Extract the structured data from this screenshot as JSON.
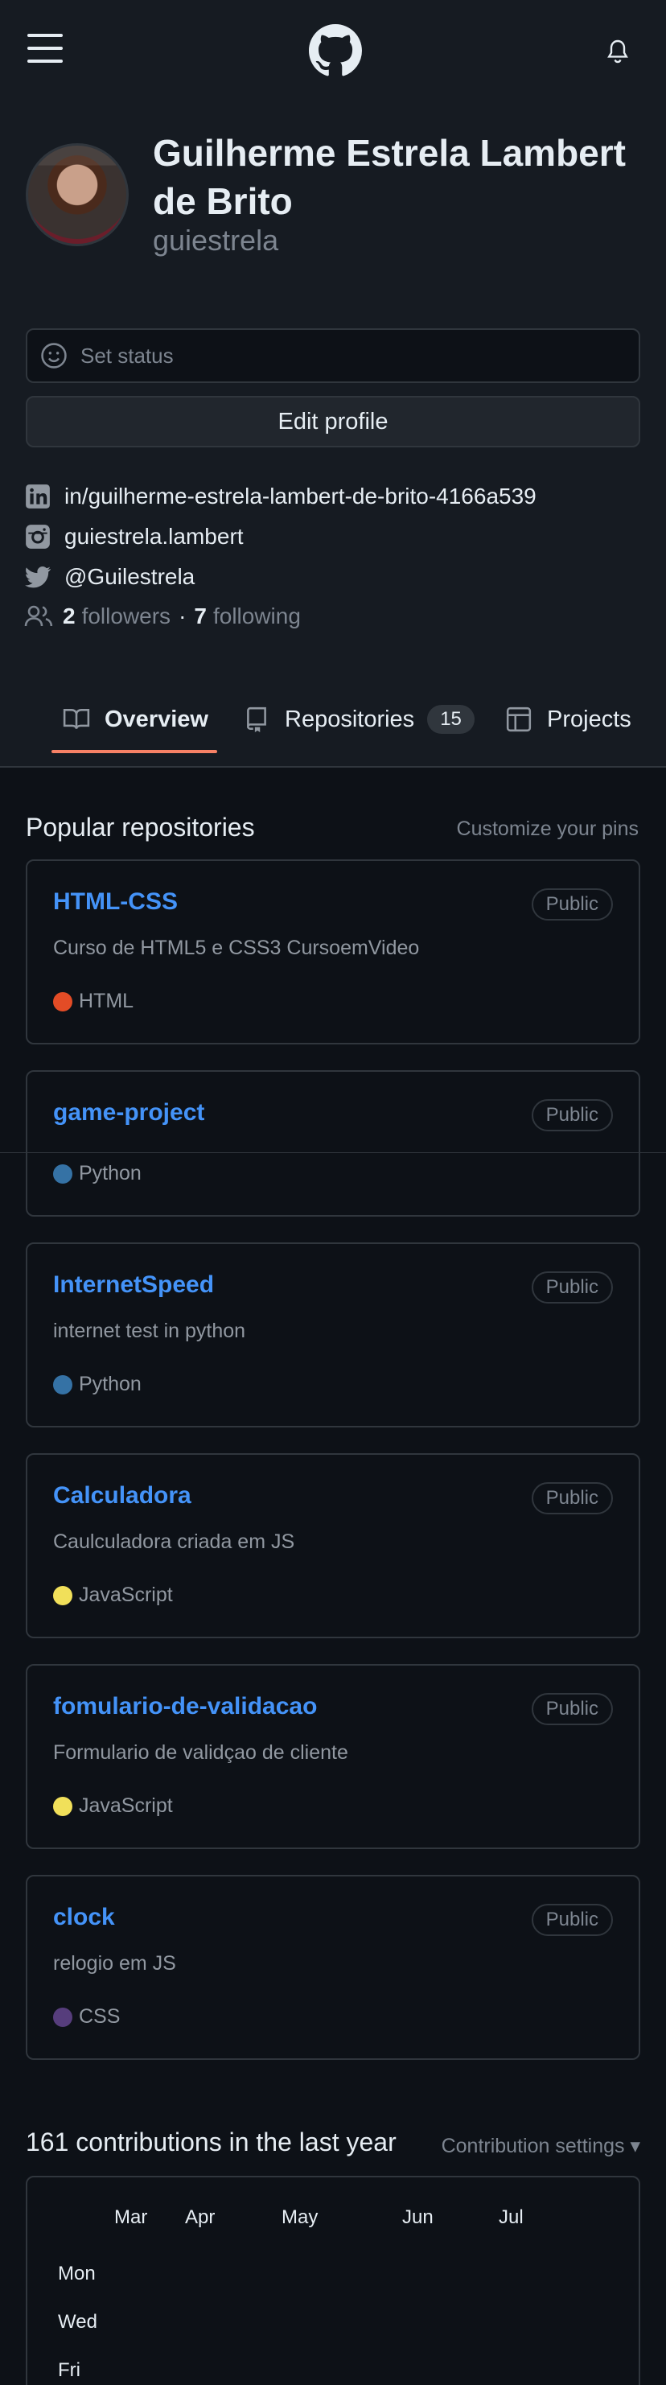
{
  "header": {
    "menu_icon": "hamburger-icon",
    "logo_icon": "github-logo-icon",
    "bell_icon": "bell-icon"
  },
  "profile": {
    "name": "Guilherme Estrela Lambert de Brito",
    "login": "guiestrela",
    "status_placeholder": "Set status",
    "edit_label": "Edit profile",
    "links": [
      {
        "icon": "linkedin-icon",
        "text": "in/guilherme-estrela-lambert-de-brito-4166a539"
      },
      {
        "icon": "instagram-icon",
        "text": "guiestrela.lambert"
      },
      {
        "icon": "twitter-icon",
        "text": "@Guilestrela"
      }
    ],
    "followers_count": "2",
    "followers_label": "followers",
    "following_count": "7",
    "following_label": "following",
    "separator": "·"
  },
  "tabs": [
    {
      "label": "Overview",
      "icon": "book-icon",
      "active": true
    },
    {
      "label": "Repositories",
      "icon": "repo-icon",
      "count": "15"
    },
    {
      "label": "Projects",
      "icon": "table-icon"
    }
  ],
  "popular": {
    "title": "Popular repositories",
    "customize": "Customize your pins",
    "repos": [
      {
        "name": "HTML-CSS",
        "visibility": "Public",
        "description": "Curso de HTML5 e CSS3 CursoemVideo",
        "language": "HTML",
        "lang_color": "#e34c26"
      },
      {
        "name": "game-project",
        "visibility": "Public",
        "description": "",
        "language": "Python",
        "lang_color": "#3572A5"
      },
      {
        "name": "InternetSpeed",
        "visibility": "Public",
        "description": "internet test in python",
        "language": "Python",
        "lang_color": "#3572A5"
      },
      {
        "name": "Calculadora",
        "visibility": "Public",
        "description": "Caulculadora criada em JS",
        "language": "JavaScript",
        "lang_color": "#f1e05a"
      },
      {
        "name": "fomulario-de-validacao",
        "visibility": "Public",
        "description": "Formulario de validçao de cliente",
        "language": "JavaScript",
        "lang_color": "#f1e05a"
      },
      {
        "name": "clock",
        "visibility": "Public",
        "description": "relogio em JS",
        "language": "CSS",
        "lang_color": "#563d7c"
      }
    ]
  },
  "contributions": {
    "title": "161 contributions in the last year",
    "settings": "Contribution settings ▾",
    "months": [
      "Mar",
      "Apr",
      "May",
      "Jun",
      "Jul"
    ],
    "days": [
      "Mon",
      "Wed",
      "Fri"
    ]
  },
  "colors": {
    "accent": "#f78166",
    "link": "#4493f8",
    "bg": "#0d1117",
    "panel": "#161b22",
    "border": "#30363d"
  }
}
